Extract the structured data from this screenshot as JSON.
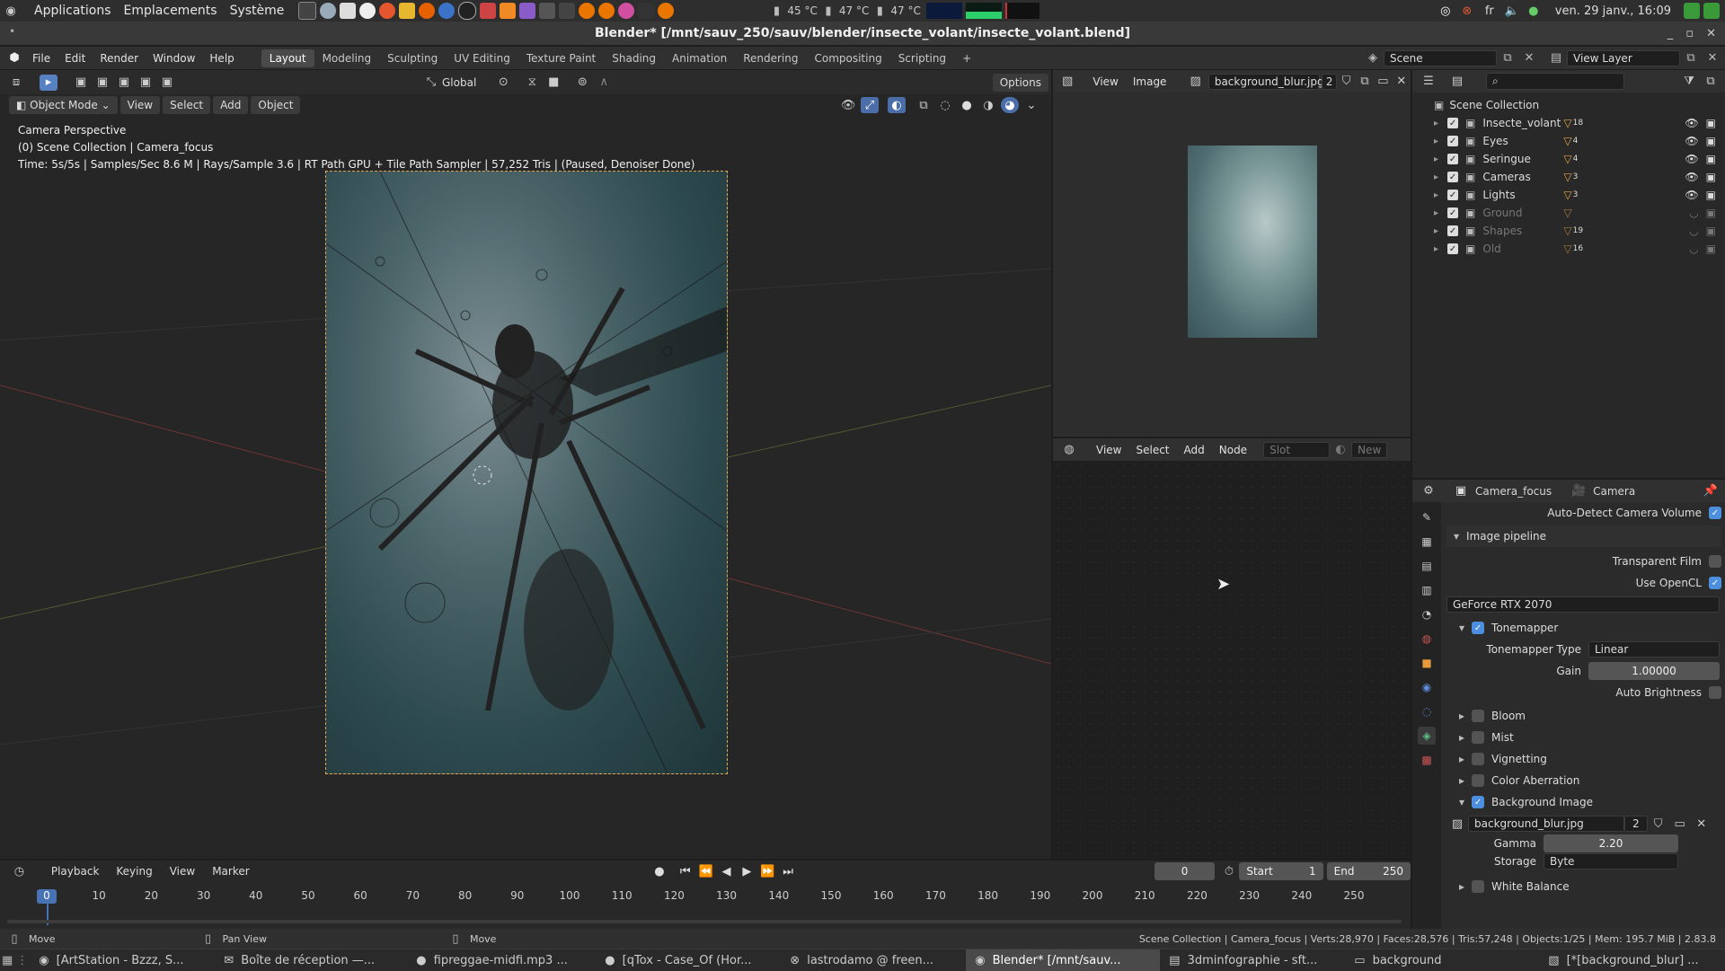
{
  "os_panel": {
    "menus": [
      "Applications",
      "Emplacements",
      "Système"
    ],
    "temps": [
      "45 °C",
      "47 °C",
      "47 °C"
    ],
    "lang": "fr",
    "clock": "ven. 29 janv., 16:09"
  },
  "window": {
    "title": "Blender* [/mnt/sauv_250/sauv/blender/insecte_volant/insecte_volant.blend]",
    "controls": [
      "_",
      "▫",
      "✕"
    ]
  },
  "topbar": {
    "menus": [
      "File",
      "Edit",
      "Render",
      "Window",
      "Help"
    ],
    "workspaces": [
      "Layout",
      "Modeling",
      "Sculpting",
      "UV Editing",
      "Texture Paint",
      "Shading",
      "Animation",
      "Rendering",
      "Compositing",
      "Scripting"
    ],
    "active_workspace": "Layout",
    "scene": "Scene",
    "view_layer": "View Layer"
  },
  "viewport": {
    "orientation": "Global",
    "options_label": "Options",
    "mode": "Object Mode",
    "menus": [
      "View",
      "Select",
      "Add",
      "Object"
    ],
    "overlay_line1": "Camera Perspective",
    "overlay_line2": "(0) Scene Collection | Camera_focus",
    "overlay_line3": "Time: 5s/5s | Samples/Sec 8.6 M | Rays/Sample 3.6 | RT Path GPU + Tile Path Sampler | 57,252 Tris | (Paused, Denoiser Done)"
  },
  "image_editor": {
    "menus": [
      "View",
      "Image"
    ],
    "image_name": "background_blur.jpg",
    "users": "2"
  },
  "node_editor": {
    "menus": [
      "View",
      "Select",
      "Add",
      "Node"
    ],
    "slot": "Slot",
    "new_label": "New"
  },
  "outliner": {
    "root": "Scene Collection",
    "items": [
      {
        "name": "Insecte_volant",
        "dim": false,
        "badge": "18"
      },
      {
        "name": "Eyes",
        "dim": false,
        "badge": "4"
      },
      {
        "name": "Seringue",
        "dim": false,
        "badge": "4"
      },
      {
        "name": "Cameras",
        "dim": false,
        "badge": "3"
      },
      {
        "name": "Lights",
        "dim": false,
        "badge": "3"
      },
      {
        "name": "Ground",
        "dim": true,
        "badge": ""
      },
      {
        "name": "Shapes",
        "dim": true,
        "badge": "19"
      },
      {
        "name": "Old",
        "dim": true,
        "badge": "16"
      }
    ]
  },
  "properties": {
    "object": "Camera_focus",
    "data": "Camera",
    "auto_detect": "Auto-Detect Camera Volume",
    "image_pipeline": "Image pipeline",
    "transparent_film": "Transparent Film",
    "use_opencl": "Use OpenCL",
    "device": "GeForce RTX 2070",
    "tonemapper": "Tonemapper",
    "tonemapper_type_label": "Tonemapper Type",
    "tonemapper_type": "Linear",
    "gain_label": "Gain",
    "gain": "1.00000",
    "auto_brightness": "Auto Brightness",
    "sections": [
      "Bloom",
      "Mist",
      "Vignetting",
      "Color Aberration"
    ],
    "background_image": "Background Image",
    "bg_file": "background_blur.jpg",
    "bg_users": "2",
    "gamma_label": "Gamma",
    "gamma": "2.20",
    "storage_label": "Storage",
    "storage": "Byte",
    "white_balance": "White Balance"
  },
  "timeline": {
    "menus": [
      "Playback",
      "Keying",
      "View",
      "Marker"
    ],
    "current_frame": "0",
    "start_label": "Start",
    "start": "1",
    "end_label": "End",
    "end": "250",
    "ticks": [
      "0",
      "10",
      "20",
      "30",
      "40",
      "50",
      "60",
      "70",
      "80",
      "90",
      "100",
      "110",
      "120",
      "130",
      "140",
      "150",
      "160",
      "170",
      "180",
      "190",
      "200",
      "210",
      "220",
      "230",
      "240",
      "250"
    ]
  },
  "status": {
    "left": "Move",
    "mid1": "Pan View",
    "mid2": "Move",
    "right": "Scene Collection | Camera_focus | Verts:28,970 | Faces:28,576 | Tris:57,248 | Objects:1/25 | Mem: 195.7 MiB | 2.83.8"
  },
  "taskbar": {
    "tasks": [
      "[ArtStation - Bzzz, S...",
      "Boîte de réception —...",
      "fipreggae-midfi.mp3 ...",
      "[qTox - Case_Of (Hor...",
      "lastrodamo @ freen...",
      "Blender* [/mnt/sauv...",
      "3dminfographie - sft...",
      "background",
      "[*[background_blur] ..."
    ],
    "active_index": 5
  }
}
